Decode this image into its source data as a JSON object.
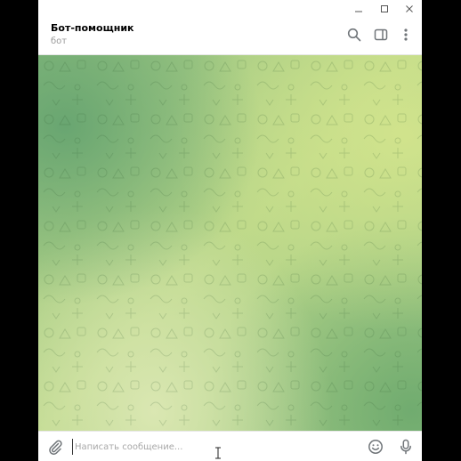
{
  "window": {
    "controls": {
      "minimize_icon": "minimize-icon",
      "maximize_icon": "maximize-icon",
      "close_icon": "close-icon"
    }
  },
  "header": {
    "title": "Бот-помощник",
    "subtitle": "бот",
    "actions": [
      "search-icon",
      "sidebar-toggle-icon",
      "more-vertical-icon"
    ]
  },
  "chat": {
    "background_colors": [
      "#60a06e",
      "#d2e48c",
      "#dce8b4",
      "#6eaa6e"
    ]
  },
  "composer": {
    "placeholder": "Написать сообщение...",
    "value": "",
    "icons": [
      "paperclip-icon",
      "emoji-icon",
      "microphone-icon"
    ]
  },
  "colors": {
    "icon": "#707579",
    "placeholder": "#a8a8a8",
    "title": "#000000",
    "subtitle": "#999999"
  }
}
